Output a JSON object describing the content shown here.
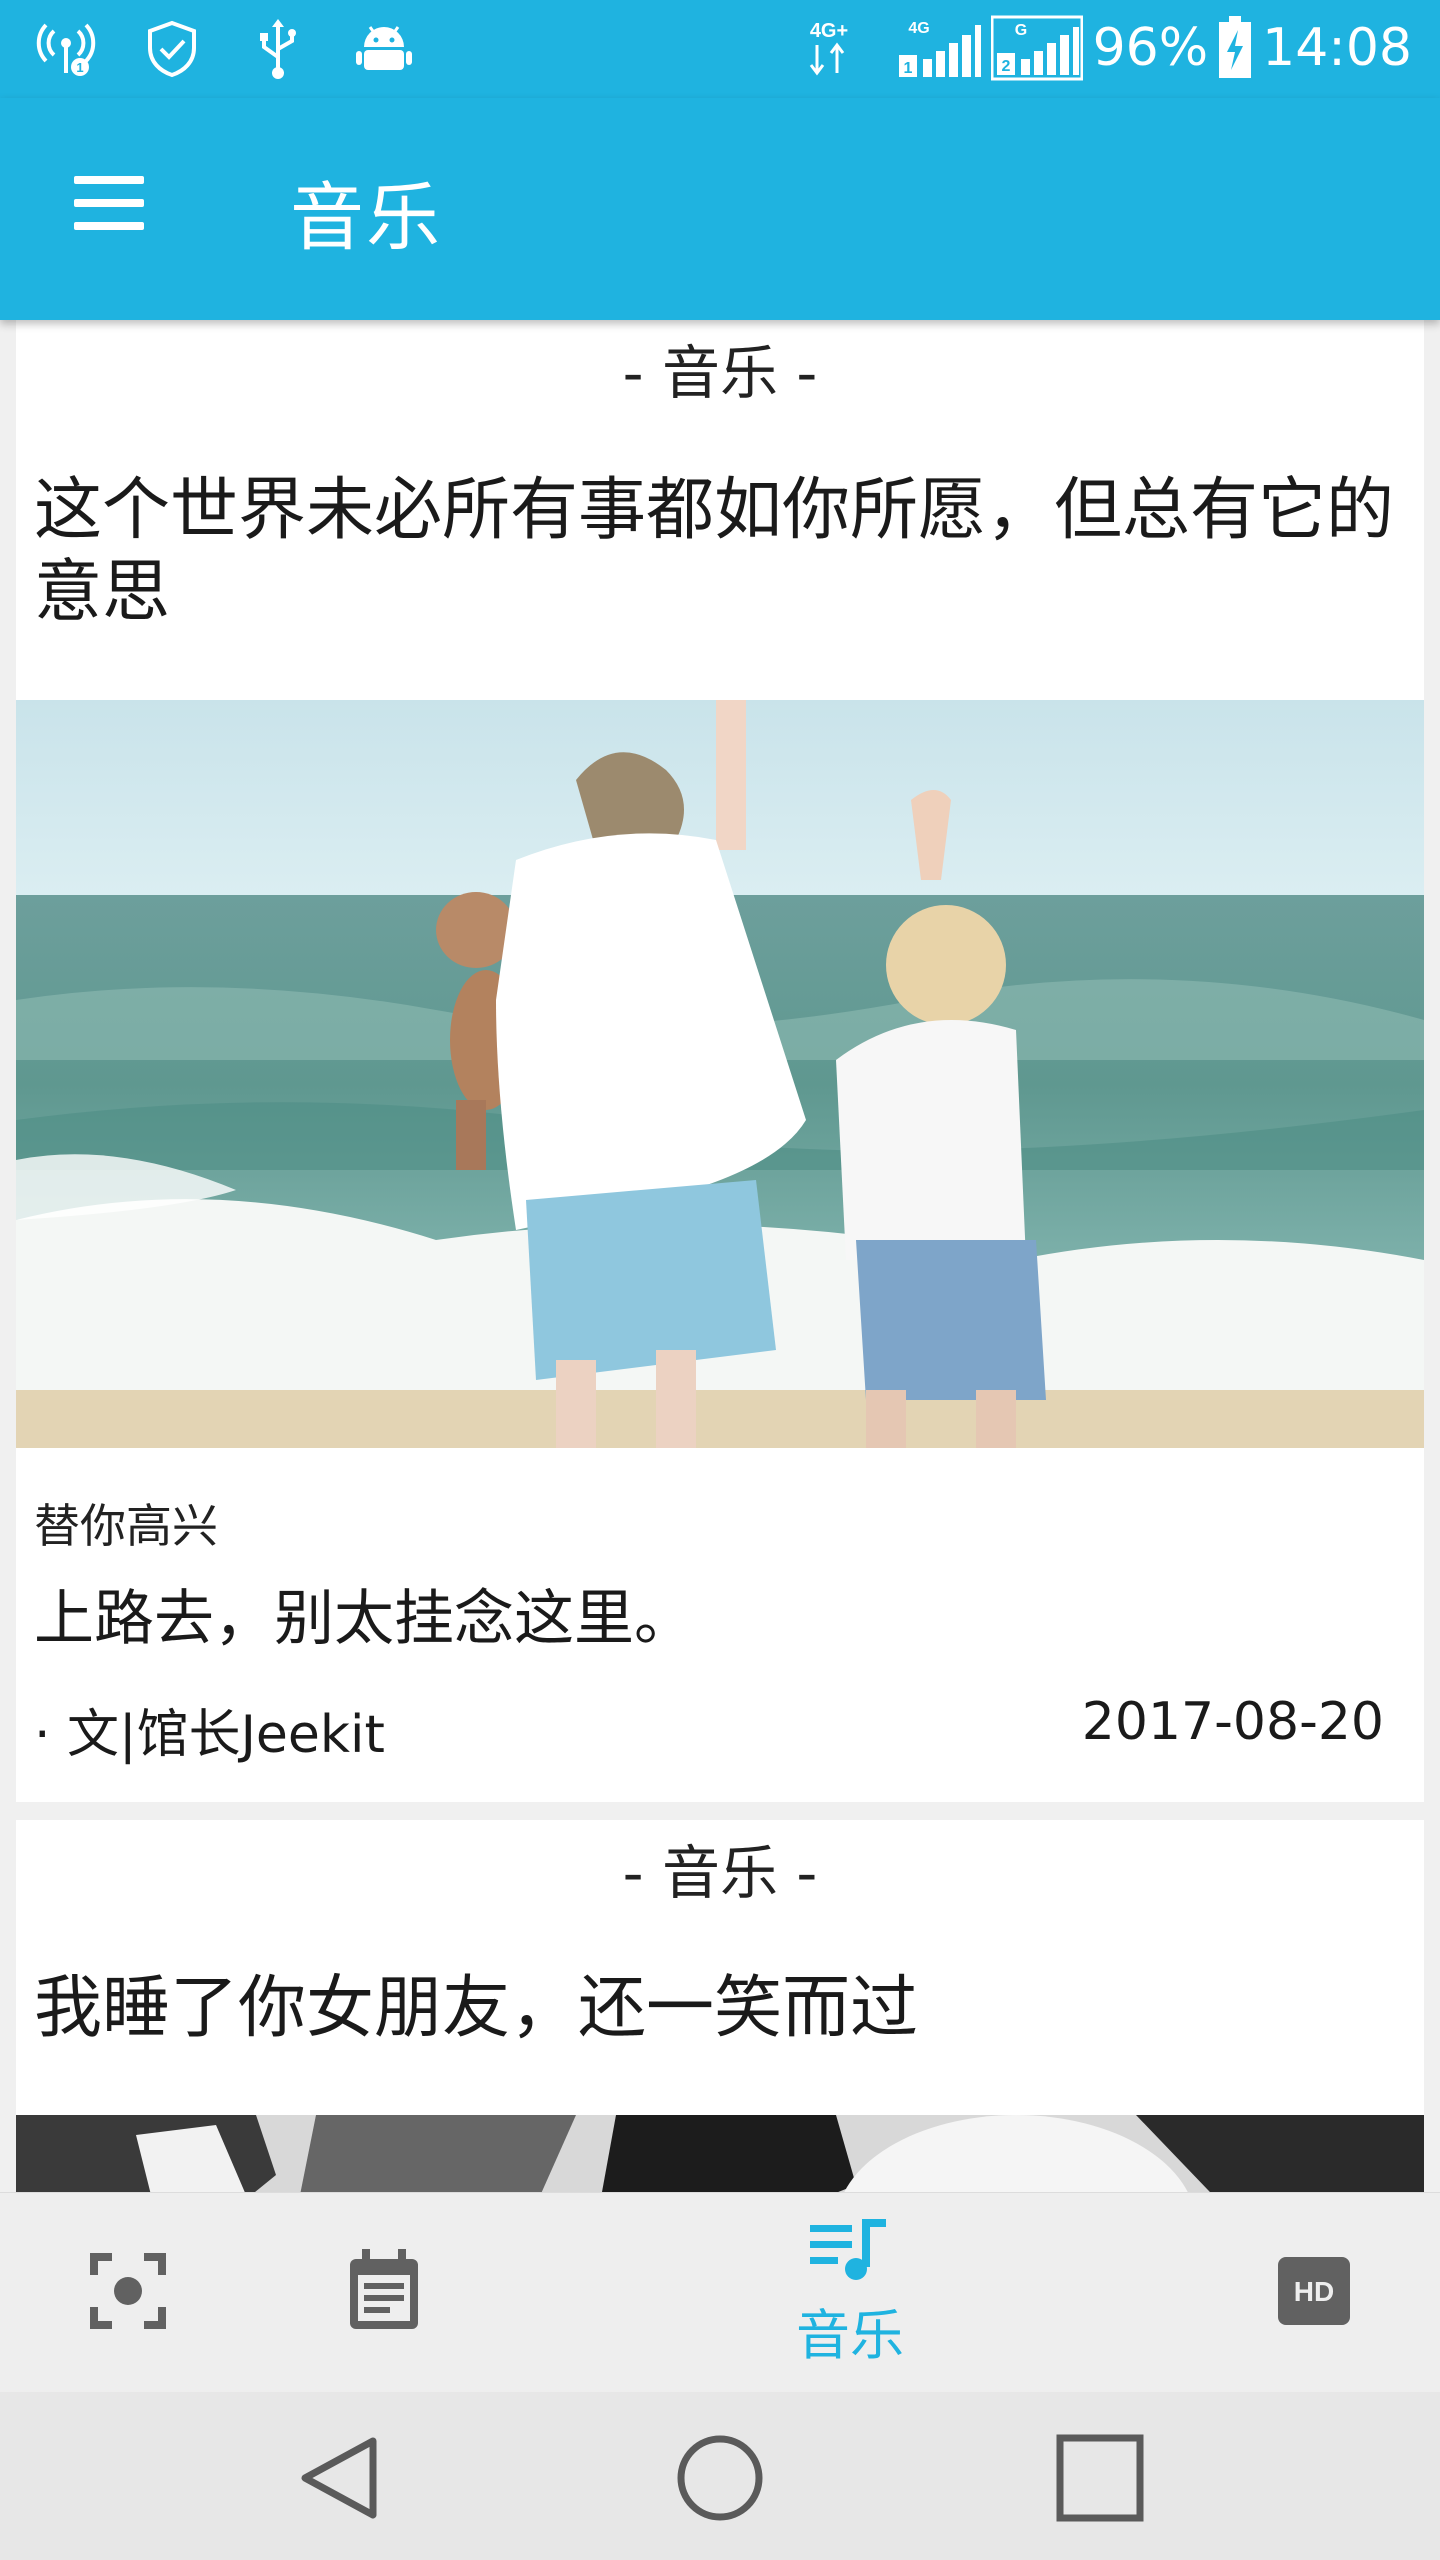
{
  "status_bar": {
    "battery": "96%",
    "time": "14:08",
    "network_1": "4G+",
    "network_2": "4G",
    "network_3": "G",
    "sim_1": "1",
    "sim_2": "2",
    "icons": [
      "hotspot-icon",
      "shield-check-icon",
      "usb-icon",
      "android-icon"
    ]
  },
  "app_bar": {
    "title": "音乐",
    "menu_icon": "menu-icon"
  },
  "feed": [
    {
      "tag": "- 音乐 -",
      "title": "这个世界未必所有事都如你所愿，但总有它的意思",
      "image": "kids-at-beach-photo",
      "subtitle": "替你高兴",
      "quote": "上路去，别太挂念这里。",
      "author": "· 文|馆长Jeekit",
      "date": "2017-08-20"
    },
    {
      "tag": "- 音乐 -",
      "title": "我睡了你女朋友，还一笑而过",
      "image": "black-white-photo"
    }
  ],
  "bottom_nav": {
    "items": [
      {
        "icon": "focus-icon",
        "label": ""
      },
      {
        "icon": "calendar-note-icon",
        "label": ""
      },
      {
        "icon": "music-list-icon",
        "label": "音乐"
      },
      {
        "icon": "hd-icon",
        "label": "HD"
      }
    ],
    "active_color": "#1fb3e0",
    "inactive_color": "#616161"
  },
  "colors": {
    "primary": "#1fb3e0",
    "background": "#f0f0f0",
    "card": "#ffffff"
  }
}
